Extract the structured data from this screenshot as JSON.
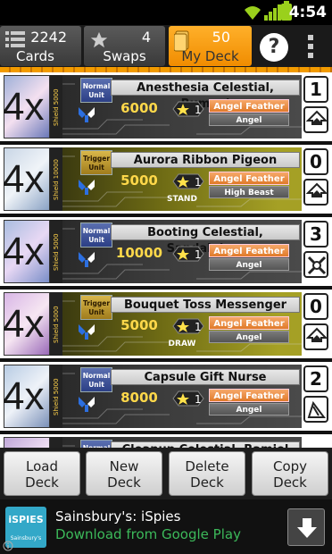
{
  "status": {
    "time": "4:54"
  },
  "tabs": {
    "cards": {
      "count": "2242",
      "label": "Cards",
      "icon": "list-icon"
    },
    "swaps": {
      "count": "4",
      "label": "Swaps",
      "icon": "star-icon"
    },
    "mydeck": {
      "count": "50",
      "label": "My Deck",
      "icon": "deck-icon"
    }
  },
  "help_label": "?",
  "rows": [
    {
      "qty": "4x",
      "shield": "Shield 5000",
      "unit": "Normal Unit",
      "name": "Anesthesia Celestial, Rumael",
      "power": "6000",
      "crit": "1",
      "clan": "Angel Feather",
      "race": "Angel",
      "trigger": "",
      "grade": "1",
      "skill": "boost"
    },
    {
      "qty": "4x",
      "shield": "Shield 10000",
      "unit": "Trigger Unit",
      "name": "Aurora Ribbon Pigeon",
      "power": "5000",
      "crit": "1",
      "clan": "Angel Feather",
      "race": "High Beast",
      "trigger": "STAND",
      "grade": "0",
      "skill": "boost"
    },
    {
      "qty": "4x",
      "shield": "Shield 5000",
      "unit": "Normal Unit",
      "name": "Booting Celestial, Sandalphon",
      "power": "10000",
      "crit": "1",
      "clan": "Angel Feather",
      "race": "Angel",
      "trigger": "",
      "grade": "3",
      "skill": "twin-drive"
    },
    {
      "qty": "4x",
      "shield": "Shield 5000",
      "unit": "Trigger Unit",
      "name": "Bouquet Toss Messenger",
      "power": "5000",
      "crit": "1",
      "clan": "Angel Feather",
      "race": "Angel",
      "trigger": "DRAW",
      "grade": "0",
      "skill": "boost"
    },
    {
      "qty": "4x",
      "shield": "Shield 5000",
      "unit": "Normal Unit",
      "name": "Capsule Gift Nurse",
      "power": "8000",
      "crit": "1",
      "clan": "Angel Feather",
      "race": "Angel",
      "trigger": "",
      "grade": "2",
      "skill": "intercept"
    },
    {
      "qty": "",
      "shield": "",
      "unit": "Normal Unit",
      "name": "Cleanup Celestial, Ramiel \"Reverse\"",
      "power": "",
      "crit": "",
      "clan": "",
      "race": "",
      "trigger": "",
      "grade": "",
      "skill": ""
    }
  ],
  "buttons": {
    "load": [
      "Load",
      "Deck"
    ],
    "new": [
      "New",
      "Deck"
    ],
    "delete": [
      "Delete",
      "Deck"
    ],
    "copy": [
      "Copy",
      "Deck"
    ]
  },
  "ad": {
    "logo_text": "iSPIES",
    "logo_sub": "Sainsbury's",
    "title": "Sainsbury's: iSpies",
    "subtitle": "Download from Google Play"
  },
  "colors": {
    "accent": "#f29b00",
    "clan": "#e07a2a",
    "ad_sub": "#3cb95a"
  }
}
